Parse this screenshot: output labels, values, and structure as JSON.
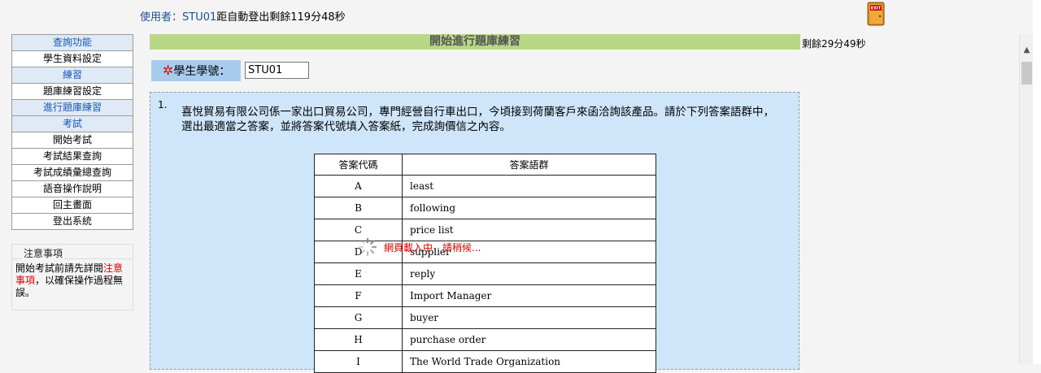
{
  "top": {
    "user_label": "使用者：",
    "user_id": "STU01",
    "logout_text": "距自動登出剩餘119分48秒",
    "exit_icon_text": "EXIT"
  },
  "sidebar": {
    "items": [
      {
        "label": "查詢功能",
        "type": "header"
      },
      {
        "label": "學生資料設定",
        "type": "link"
      },
      {
        "label": "練習",
        "type": "header"
      },
      {
        "label": "題庫練習設定",
        "type": "link"
      },
      {
        "label": "進行題庫練習",
        "type": "header"
      },
      {
        "label": "考試",
        "type": "header"
      },
      {
        "label": "開始考試",
        "type": "link"
      },
      {
        "label": "考試結果查詢",
        "type": "link"
      },
      {
        "label": "考試成績彙總查詢",
        "type": "link"
      },
      {
        "label": "語音操作說明",
        "type": "link"
      },
      {
        "label": "回主畫面",
        "type": "link"
      },
      {
        "label": "登出系統",
        "type": "link"
      }
    ]
  },
  "notes": {
    "title": "注意事項",
    "text_before": "開始考試前請先詳閱",
    "text_red": "注意事項",
    "text_after": "，以確保操作過程無誤。"
  },
  "main": {
    "title": "開始進行題庫練習",
    "remaining": "剩餘29分49秒",
    "student_id_label": "學生學號：",
    "student_id_value": "STU01",
    "question_number": "1.",
    "question_text": "喜悅貿易有限公司係一家出口貿易公司，專門經營自行車出口，今頃接到荷蘭客戶來函洽詢該產品。請於下列答案語群中，選出最適當之答案，並將答案代號填入答案紙，完成詢價信之內容。",
    "table": {
      "headers": [
        "答案代碼",
        "答案語群"
      ],
      "rows": [
        [
          "A",
          "least"
        ],
        [
          "B",
          "following"
        ],
        [
          "C",
          "price list"
        ],
        [
          "D",
          "supplier"
        ],
        [
          "E",
          "reply"
        ],
        [
          "F",
          "Import Manager"
        ],
        [
          "G",
          "buyer"
        ],
        [
          "H",
          "purchase order"
        ],
        [
          "I",
          "The World Trade Organization"
        ]
      ]
    },
    "loading_text": "網頁載入中，請稍候..."
  }
}
